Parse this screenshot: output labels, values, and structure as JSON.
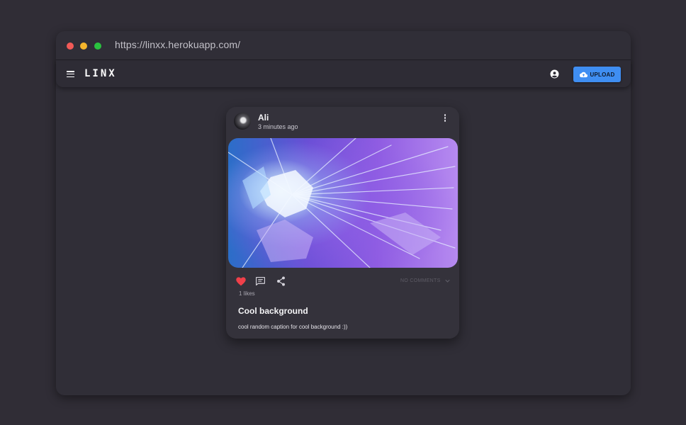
{
  "browser": {
    "url": "https://linxx.herokuapp.com/"
  },
  "appbar": {
    "logo": "LINX",
    "upload_label": "UPLOAD",
    "icons": {
      "menu": "menu-icon",
      "account": "account-circle-icon",
      "upload": "cloud-upload-icon"
    },
    "accent_color": "#3f8ef2"
  },
  "post": {
    "author": "Ali",
    "time": "3 minutes ago",
    "likes": "1 likes",
    "liked": true,
    "comments_toggle": "NO COMMENTS",
    "title": "Cool background",
    "caption": "cool random caption for cool background :))",
    "icons": {
      "like": "heart-icon",
      "comment": "comment-icon",
      "share": "share-icon",
      "more": "more-vertical-icon",
      "expand": "chevron-down-icon"
    },
    "like_color": "#f0404a"
  }
}
